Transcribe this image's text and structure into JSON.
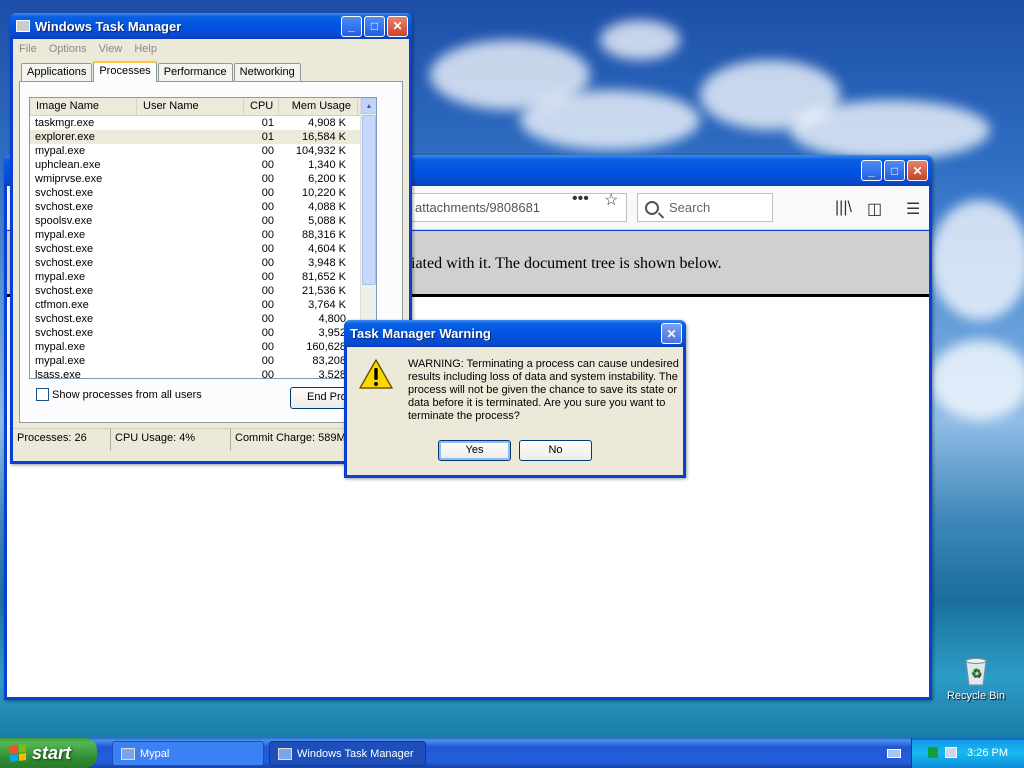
{
  "taskmgr": {
    "title": "Windows Task Manager",
    "menu": [
      "File",
      "Options",
      "View",
      "Help"
    ],
    "tabs": [
      "Applications",
      "Processes",
      "Performance",
      "Networking"
    ],
    "active_tab": "Processes",
    "columns": [
      "Image Name",
      "User Name",
      "CPU",
      "Mem Usage"
    ],
    "processes": [
      {
        "name": "taskmgr.exe",
        "user": "",
        "cpu": "01",
        "mem": "4,908 K"
      },
      {
        "name": "explorer.exe",
        "user": "",
        "cpu": "01",
        "mem": "16,584 K"
      },
      {
        "name": "mypal.exe",
        "user": "",
        "cpu": "00",
        "mem": "104,932 K"
      },
      {
        "name": "uphclean.exe",
        "user": "",
        "cpu": "00",
        "mem": "1,340 K"
      },
      {
        "name": "wmiprvse.exe",
        "user": "",
        "cpu": "00",
        "mem": "6,200 K"
      },
      {
        "name": "svchost.exe",
        "user": "",
        "cpu": "00",
        "mem": "10,220 K"
      },
      {
        "name": "svchost.exe",
        "user": "",
        "cpu": "00",
        "mem": "4,088 K"
      },
      {
        "name": "spoolsv.exe",
        "user": "",
        "cpu": "00",
        "mem": "5,088 K"
      },
      {
        "name": "mypal.exe",
        "user": "",
        "cpu": "00",
        "mem": "88,316 K"
      },
      {
        "name": "svchost.exe",
        "user": "",
        "cpu": "00",
        "mem": "4,604 K"
      },
      {
        "name": "svchost.exe",
        "user": "",
        "cpu": "00",
        "mem": "3,948 K"
      },
      {
        "name": "mypal.exe",
        "user": "",
        "cpu": "00",
        "mem": "81,652 K"
      },
      {
        "name": "svchost.exe",
        "user": "",
        "cpu": "00",
        "mem": "21,536 K"
      },
      {
        "name": "ctfmon.exe",
        "user": "",
        "cpu": "00",
        "mem": "3,764 K"
      },
      {
        "name": "svchost.exe",
        "user": "",
        "cpu": "00",
        "mem": "4,800"
      },
      {
        "name": "svchost.exe",
        "user": "",
        "cpu": "00",
        "mem": "3,952"
      },
      {
        "name": "mypal.exe",
        "user": "",
        "cpu": "00",
        "mem": "160,628"
      },
      {
        "name": "mypal.exe",
        "user": "",
        "cpu": "00",
        "mem": "83,208"
      },
      {
        "name": "lsass.exe",
        "user": "",
        "cpu": "00",
        "mem": "3,528"
      }
    ],
    "show_all_label": "Show processes from all users",
    "end_process_label": "End Pro",
    "status": {
      "processes": "Processes: 26",
      "cpu": "CPU Usage: 4%",
      "commit": "Commit Charge: 589M /"
    }
  },
  "browser": {
    "url_fragment": "attachments/9808681",
    "search_placeholder": "Search",
    "content_text": "iated with it. The document tree is shown below."
  },
  "warning_dialog": {
    "title": "Task Manager Warning",
    "message": "WARNING: Terminating a process can cause undesired results including loss of data and system instability. The process will not be given the chance to save its state or data before it is terminated.  Are you sure you want to terminate the process?",
    "yes_label": "Yes",
    "no_label": "No"
  },
  "desktop": {
    "recycle_bin_label": "Recycle Bin"
  },
  "taskbar": {
    "start_label": "start",
    "tasks": [
      "Mypal",
      "Windows Task Manager"
    ],
    "clock": "3:26 PM"
  }
}
